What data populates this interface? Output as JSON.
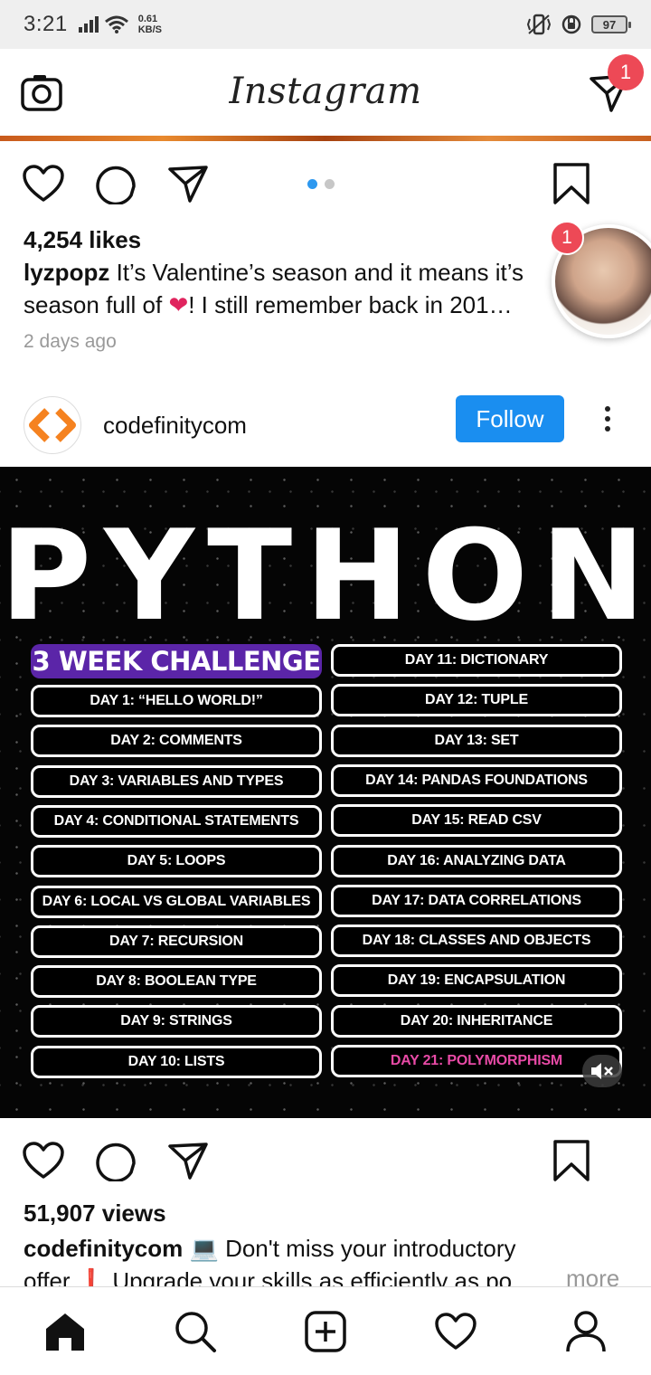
{
  "status_bar": {
    "time": "3:21",
    "speed_value": "0.61",
    "speed_unit": "KB/S",
    "battery": "97"
  },
  "app_bar": {
    "logo": "Instagram",
    "dm_badge": "1"
  },
  "post1": {
    "likes": "4,254 likes",
    "username": "lyzpopz",
    "caption_line1": "It’s Valentine’s season and it means it’s",
    "caption_line2_a": "season full of ",
    "caption_emoji": "❤",
    "caption_line2_b": "! I still remember back in 201…",
    "time": "2 days ago"
  },
  "story_bubble": {
    "badge": "1"
  },
  "post2": {
    "username": "codefinitycom",
    "follow_label": "Follow",
    "media": {
      "title": "PYTHON",
      "challenge": "3 WEEK CHALLENGE",
      "left_days": [
        "DAY 1: “HELLO WORLD!”",
        "DAY 2: COMMENTS",
        "DAY 3: VARIABLES AND TYPES",
        "DAY 4: CONDITIONAL STATEMENTS",
        "DAY 5: LOOPS",
        "DAY 6: LOCAL VS GLOBAL VARIABLES",
        "DAY 7: RECURSION",
        "DAY 8: BOOLEAN TYPE",
        "DAY 9: STRINGS",
        "DAY 10: LISTS"
      ],
      "right_days": [
        "DAY 11: DICTIONARY",
        "DAY 12: TUPLE",
        "DAY 13: SET",
        "DAY 14: PANDAS FOUNDATIONS",
        "DAY 15: READ CSV",
        "DAY 16: ANALYZING DATA",
        "DAY 17: DATA CORRELATIONS",
        "DAY 18: CLASSES AND OBJECTS",
        "DAY 19: ENCAPSULATION",
        "DAY 20: INHERITANCE",
        "DAY 21: POLYMORPHISM"
      ],
      "highlight_color": "#e84aa6"
    },
    "views": "51,907 views",
    "caption_user": "codefinitycom",
    "caption_line1": " 💻 Don't miss your introductory",
    "caption_line2": "offer ❗ Upgrade your skills as efficiently as po",
    "more_label": "more"
  },
  "colors": {
    "accent": "#1a8ef0",
    "badge": "#ed4956",
    "purple": "#5b25a8"
  },
  "bottom_nav": [
    "home-icon",
    "search-icon",
    "add-post-icon",
    "activity-heart-icon",
    "profile-icon"
  ]
}
